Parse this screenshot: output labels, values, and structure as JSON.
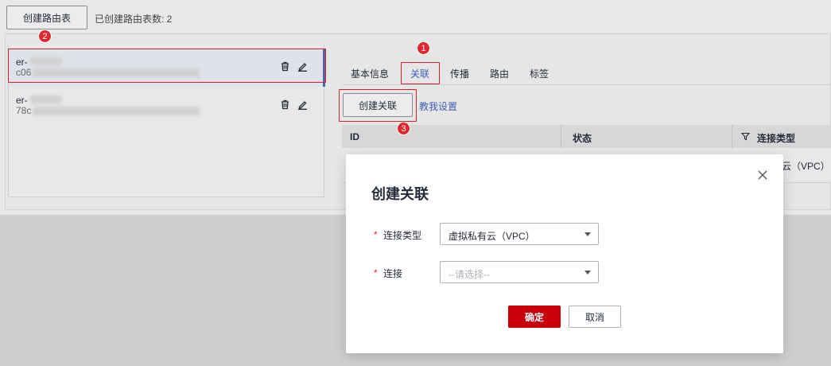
{
  "toolbar": {
    "create_table_label": "创建路由表",
    "table_count_text": "已创建路由表数: 2"
  },
  "route_tables": [
    {
      "name": "er-",
      "id": "c06",
      "selected": true
    },
    {
      "name": "er-",
      "id": "78c",
      "selected": false
    }
  ],
  "tabs": [
    {
      "label": "基本信息",
      "active": false
    },
    {
      "label": "关联",
      "active": true
    },
    {
      "label": "传播",
      "active": false
    },
    {
      "label": "路由",
      "active": false
    },
    {
      "label": "标签",
      "active": false
    }
  ],
  "association": {
    "create_button": "创建关联",
    "teach_link": "教我设置"
  },
  "table": {
    "columns": [
      "ID",
      "状态",
      "连接类型"
    ],
    "row_partial_type": "云（VPC）"
  },
  "badges": [
    "1",
    "2",
    "3"
  ],
  "modal": {
    "title": "创建关联",
    "fields": [
      {
        "label": "连接类型",
        "required": true,
        "value": "虚拟私有云（VPC）",
        "placeholder": ""
      },
      {
        "label": "连接",
        "required": true,
        "value": "",
        "placeholder": "--请选择--"
      }
    ],
    "ok_label": "确定",
    "cancel_label": "取消"
  },
  "colors": {
    "accent_blue": "#3f5fb5",
    "primary_red": "#c7000b",
    "highlight_red": "#d4202a"
  }
}
